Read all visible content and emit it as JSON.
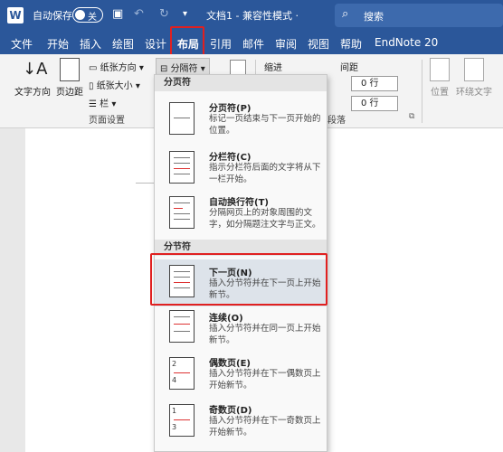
{
  "titlebar": {
    "app_icon": "W",
    "autosave_label": "自动保存",
    "autosave_state": "关",
    "doc_title": "文档1 - 兼容性模式 ·",
    "search_placeholder": "搜索"
  },
  "menu": {
    "tabs": [
      "文件",
      "开始",
      "插入",
      "绘图",
      "设计",
      "布局",
      "引用",
      "邮件",
      "审阅",
      "视图",
      "帮助",
      "EndNote 20"
    ],
    "active": "布局"
  },
  "ribbon": {
    "text_direction": "文字方向",
    "margins": "页边距",
    "orientation": "纸张方向",
    "size": "纸张大小",
    "columns": "栏",
    "breaks": "分隔符",
    "group_page_setup": "页面设置",
    "indent": "缩进",
    "spacing": "间距",
    "spin_before": "0 行",
    "spin_after": "0 行",
    "group_paragraph": "段落",
    "position": "位置",
    "wrap_text": "环绕文字"
  },
  "dropdown": {
    "section_page_breaks": "分页符",
    "section_section_breaks": "分节符",
    "items": [
      {
        "title": "分页符(P)",
        "desc": "标记一页结束与下一页开始的位置。"
      },
      {
        "title": "分栏符(C)",
        "desc": "指示分栏符后面的文字将从下一栏开始。"
      },
      {
        "title": "自动换行符(T)",
        "desc": "分隔网页上的对象周围的文字，如分隔题注文字与正文。"
      },
      {
        "title": "下一页(N)",
        "desc": "插入分节符并在下一页上开始新节。"
      },
      {
        "title": "连续(O)",
        "desc": "插入分节符并在同一页上开始新节。"
      },
      {
        "title": "偶数页(E)",
        "desc": "插入分节符并在下一偶数页上开始新节。"
      },
      {
        "title": "奇数页(D)",
        "desc": "插入分节符并在下一奇数页上开始新节。"
      }
    ],
    "even_badge_top": "2",
    "even_badge_bottom": "4",
    "odd_badge_top": "1",
    "odd_badge_bottom": "3"
  },
  "colors": {
    "titlebar": "#2b579a",
    "highlight": "#e02020"
  }
}
